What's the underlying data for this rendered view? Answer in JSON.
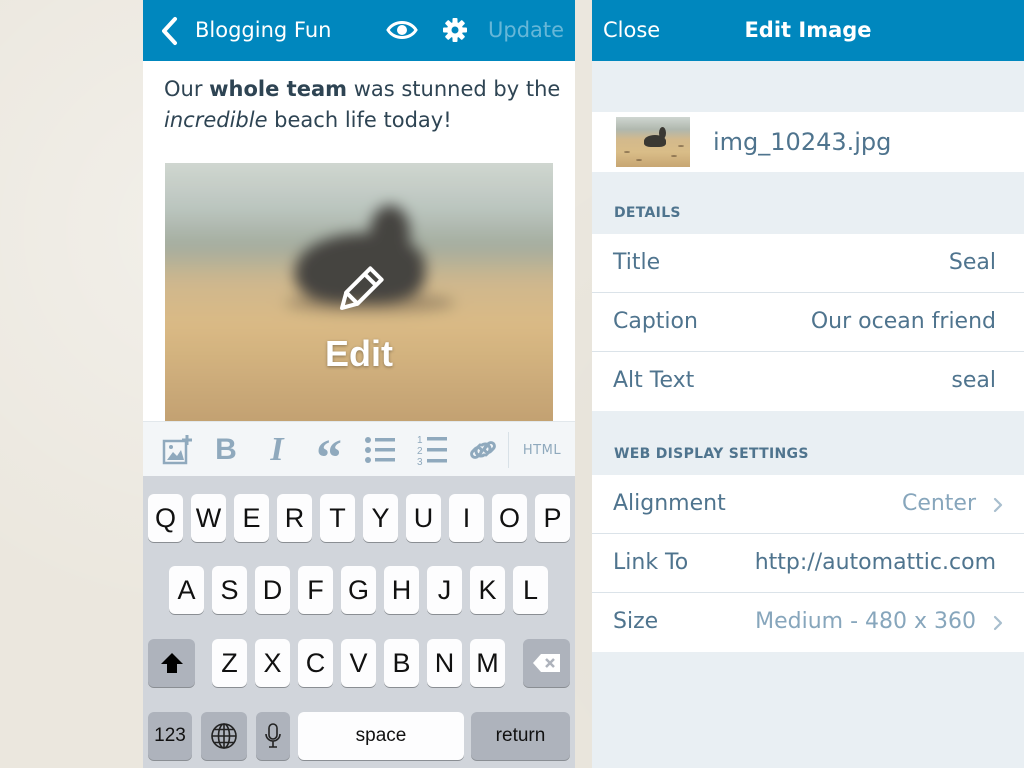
{
  "left": {
    "nav": {
      "site_title": "Blogging Fun",
      "update_label": "Update"
    },
    "post": {
      "line1_pre": "Our ",
      "line1_bold": "whole team",
      "line1_post": " was stunned by the",
      "line2_italic": "incredible",
      "line2_post": " beach life today!"
    },
    "image": {
      "edit_label": "Edit"
    },
    "format_bar": {
      "bold_label": "B",
      "italic_label": "I",
      "quote_label": "“",
      "ol_numbers": [
        "1",
        "2",
        "3"
      ],
      "html_label": "HTML",
      "icons": [
        "add-media-icon",
        "bold-icon",
        "italic-icon",
        "quote-icon",
        "unordered-list-icon",
        "ordered-list-icon",
        "link-icon"
      ]
    },
    "keyboard": {
      "row1": [
        "Q",
        "W",
        "E",
        "R",
        "T",
        "Y",
        "U",
        "I",
        "O",
        "P"
      ],
      "row2": [
        "A",
        "S",
        "D",
        "F",
        "G",
        "H",
        "J",
        "K",
        "L"
      ],
      "row3": [
        "Z",
        "X",
        "C",
        "V",
        "B",
        "N",
        "M"
      ],
      "numbers_label": "123",
      "space_label": "space",
      "return_label": "return"
    }
  },
  "right": {
    "nav": {
      "close_label": "Close",
      "title": "Edit Image"
    },
    "file_name": "img_10243.jpg",
    "details": {
      "heading": "DETAILS",
      "rows": [
        {
          "label": "Title",
          "value": "Seal"
        },
        {
          "label": "Caption",
          "value": "Our ocean friend"
        },
        {
          "label": "Alt Text",
          "value": "seal"
        }
      ]
    },
    "web_display": {
      "heading": "WEB DISPLAY SETTINGS",
      "rows": [
        {
          "label": "Alignment",
          "value": "Center"
        },
        {
          "label": "Link To",
          "value": "http://automattic.com"
        },
        {
          "label": "Size",
          "value": "Medium - 480 x 360"
        }
      ]
    }
  },
  "colors": {
    "brand_blue": "#0087be",
    "text_blue": "#4f748e",
    "muted_blue": "#87a6bc",
    "body_text": "#2e4453",
    "settings_bg": "#e9eff3"
  }
}
